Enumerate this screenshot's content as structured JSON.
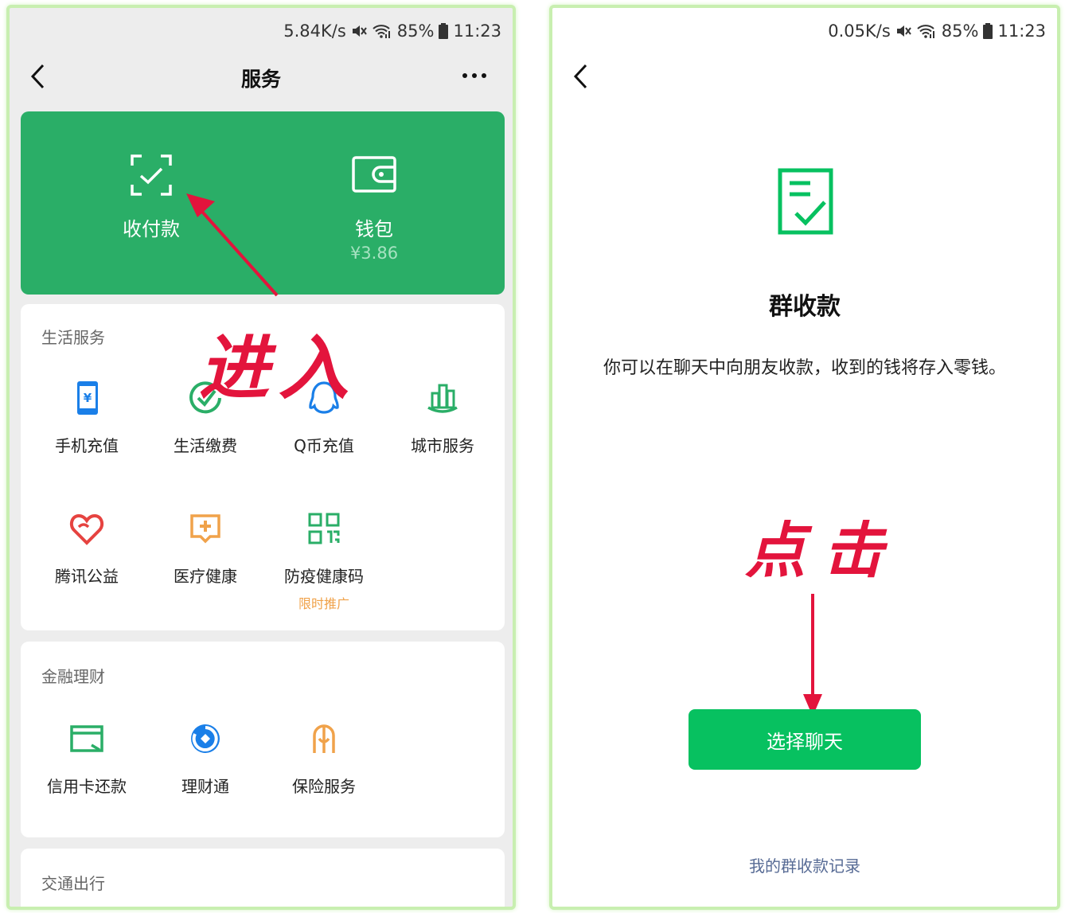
{
  "left": {
    "status": {
      "speed": "5.84K/s",
      "battery": "85%",
      "time": "11:23"
    },
    "title": "服务",
    "wallet_card": {
      "pay_label": "收付款",
      "wallet_label": "钱包",
      "wallet_balance": "¥3.86"
    },
    "annotation": "进入",
    "life": {
      "title": "生活服务",
      "items": [
        {
          "label": "手机充值",
          "icon": "phone-recharge-icon",
          "color": "#1a7fe8"
        },
        {
          "label": "生活缴费",
          "icon": "check-circle-icon",
          "color": "#2aae67"
        },
        {
          "label": "Q币充值",
          "icon": "qq-icon",
          "color": "#1a7fe8"
        },
        {
          "label": "城市服务",
          "icon": "city-icon",
          "color": "#2aae67"
        },
        {
          "label": "腾讯公益",
          "icon": "heart-icon",
          "color": "#e64340"
        },
        {
          "label": "医疗健康",
          "icon": "medical-icon",
          "color": "#f0a24a"
        },
        {
          "label": "防疫健康码",
          "icon": "qr-code-icon",
          "color": "#2aae67",
          "promo": "限时推广"
        }
      ]
    },
    "finance": {
      "title": "金融理财",
      "items": [
        {
          "label": "信用卡还款",
          "icon": "credit-card-icon",
          "color": "#2aae67"
        },
        {
          "label": "理财通",
          "icon": "wealth-icon",
          "color": "#1a7fe8"
        },
        {
          "label": "保险服务",
          "icon": "insurance-icon",
          "color": "#f0a24a"
        }
      ]
    },
    "transport": {
      "title": "交通出行"
    }
  },
  "right": {
    "status": {
      "speed": "0.05K/s",
      "battery": "85%",
      "time": "11:23"
    },
    "heading": "群收款",
    "description": "你可以在聊天中向朋友收款，收到的钱将存入零钱。",
    "annotation": "点击",
    "button_label": "选择聊天",
    "records_link": "我的群收款记录"
  },
  "colors": {
    "brand_green": "#07c160",
    "card_green": "#2aae67",
    "annotation_red": "#e3143c",
    "link_blue": "#576b95"
  }
}
